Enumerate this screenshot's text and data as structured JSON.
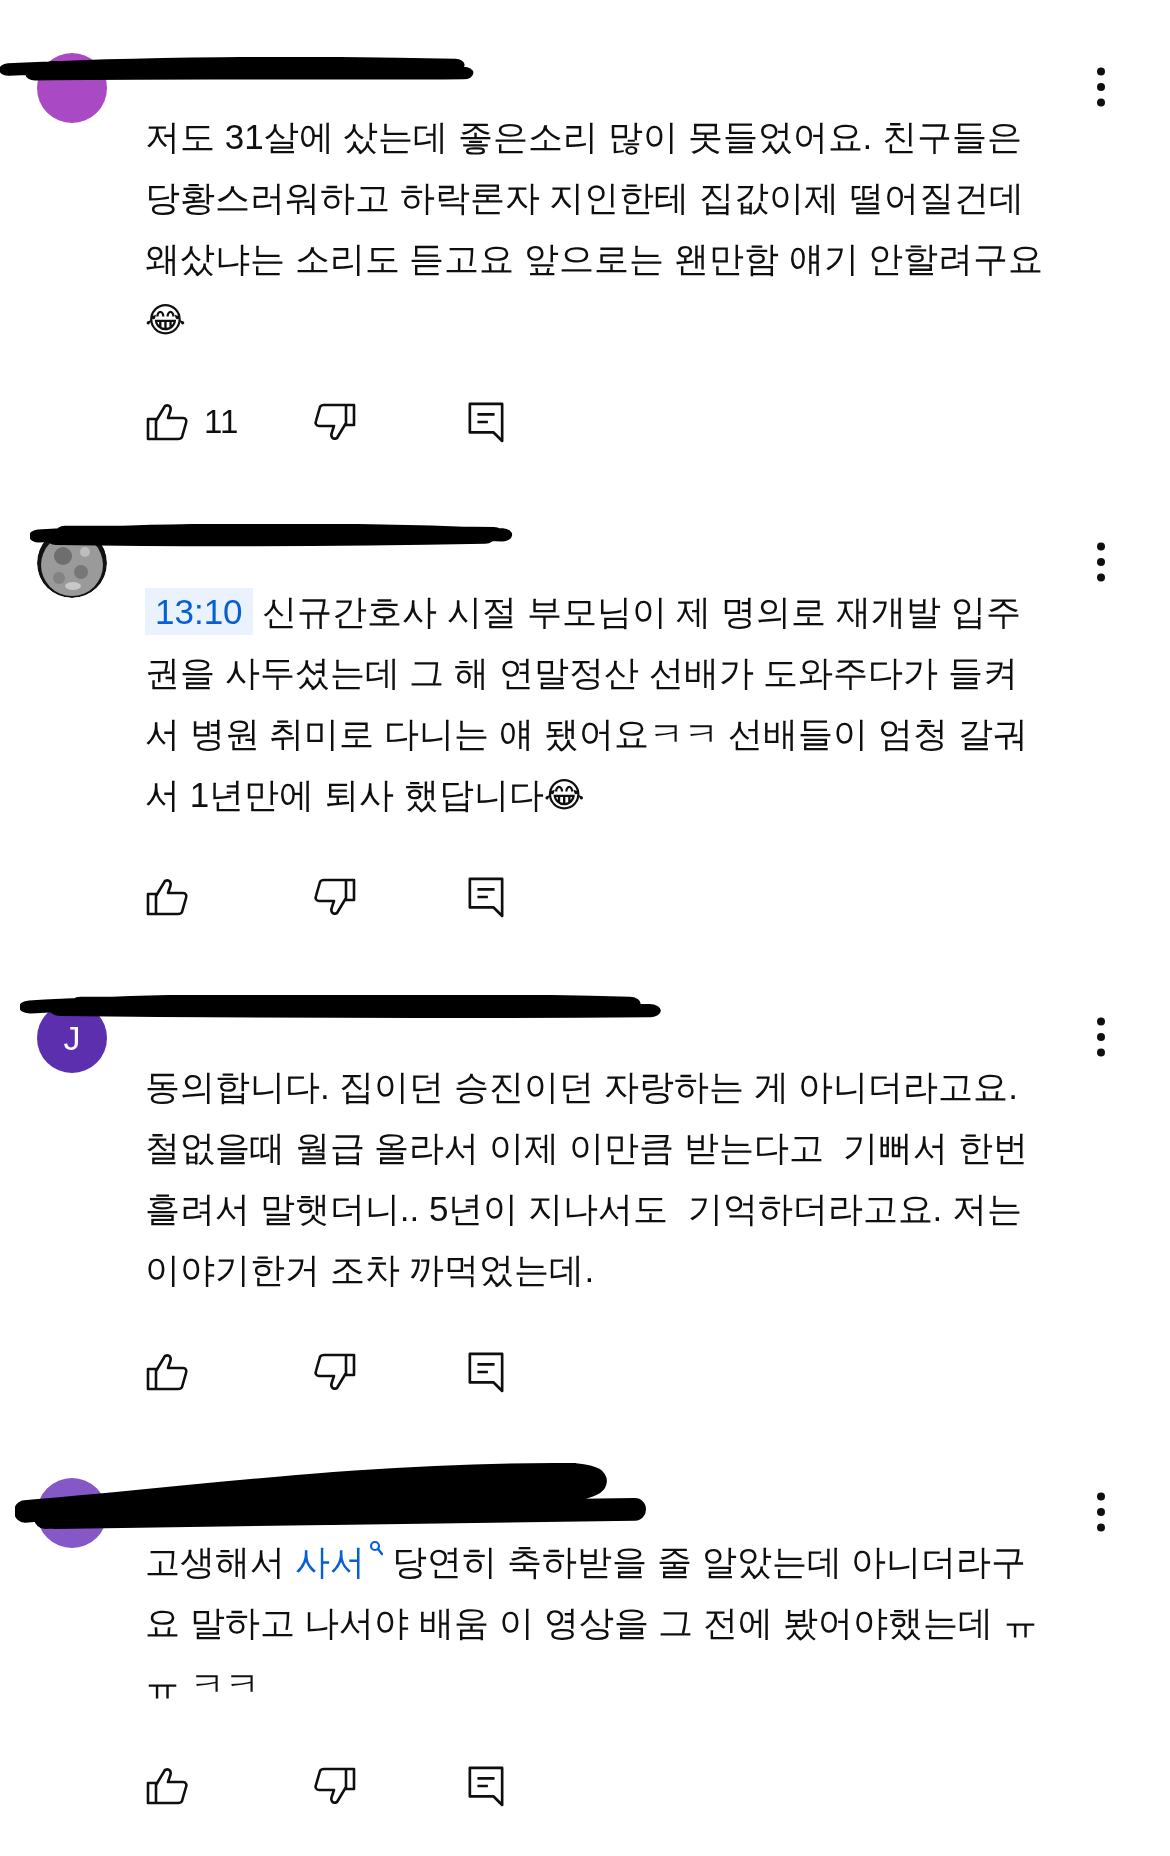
{
  "comments": [
    {
      "avatar": {
        "kind": "plain",
        "color": "#a94ac4"
      },
      "lines": [
        "저도 31살에 샀는데 좋은소리 많이 못들었어요. 친구들은",
        "당황스러워하고 하락론자 지인한테 집값이제 떨어질건데",
        "왜샀냐는 소리도 듣고요 앞으로는 왠만함 얘기 안할려구요",
        "😂"
      ],
      "likes": "11"
    },
    {
      "avatar": {
        "kind": "picture"
      },
      "lines": [
        [
          {
            "kind": "timestamp",
            "text": "13:10"
          },
          {
            "kind": "text",
            "text": " 신규간호사 시절 부모님이 제 명의로 재개발 입주"
          }
        ],
        "권을 사두셨는데 그 해 연말정산 선배가 도와주다가 들켜",
        "서 병원 취미로 다니는 얘 됐어요ㅋㅋ 선배들이 엄청 갈궈",
        "서 1년만에 퇴사 했답니다😂"
      ]
    },
    {
      "avatar": {
        "kind": "letter",
        "color": "#5b2fae",
        "letter": "J"
      },
      "lines": [
        "동의합니다. 집이던 승진이던 자랑하는 게 아니더라고요.",
        "철없을때 월급 올라서 이제 이만큼 받는다고  기뻐서 한번",
        "흘려서 말햇더니.. 5년이 지나서도  기억하더라고요. 저는",
        "이야기한거 조차 까먹었는데."
      ]
    },
    {
      "avatar": {
        "kind": "plain",
        "color": "#8657c6"
      },
      "lines": [
        [
          {
            "kind": "text",
            "text": "고생해서 "
          },
          {
            "kind": "search",
            "text": "사서"
          },
          {
            "kind": "text",
            "text": " 당연히 축하받을 줄 알았는데 아니더라구"
          }
        ],
        "요 말하고 나서야 배움 이 영상을 그 전에 봤어야했는데 ㅠ",
        "ㅠ ㅋㅋ"
      ]
    }
  ]
}
